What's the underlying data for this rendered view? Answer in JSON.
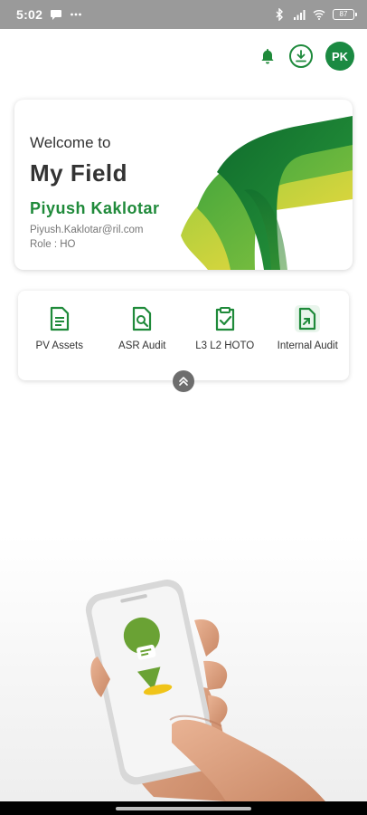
{
  "status_bar": {
    "time": "5:02",
    "battery": "87"
  },
  "header": {
    "avatar_initials": "PK"
  },
  "welcome": {
    "greeting": "Welcome to",
    "app_name": "My Field",
    "user_name": "Piyush Kaklotar",
    "email": "Piyush.Kaklotar@ril.com",
    "role": "Role : HO"
  },
  "actions": [
    {
      "label": "PV Assets",
      "icon": "document-icon"
    },
    {
      "label": "ASR Audit",
      "icon": "search-document-icon"
    },
    {
      "label": "L3 L2 HOTO",
      "icon": "clipboard-check-icon"
    },
    {
      "label": "Internal Audit",
      "icon": "document-arrow-icon"
    }
  ],
  "colors": {
    "primary_green": "#1f8a3a",
    "status_bar": "#9a9a9a",
    "ribbon_dark": "#1e7e34",
    "ribbon_light": "#7cc142",
    "ribbon_yellow": "#f2d53c"
  }
}
